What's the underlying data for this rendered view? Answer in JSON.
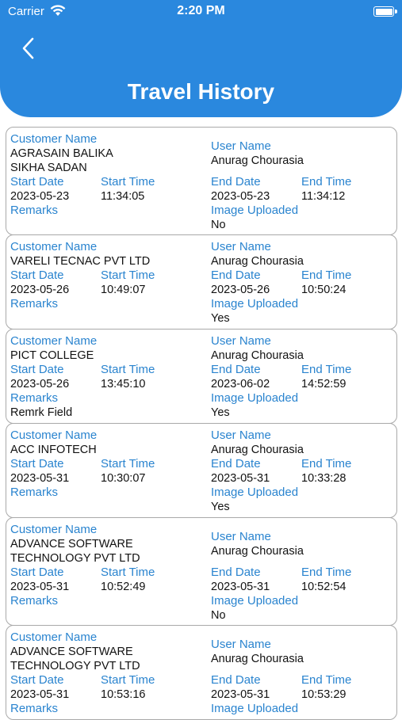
{
  "status_bar": {
    "carrier": "Carrier",
    "time": "2:20 PM"
  },
  "header": {
    "title": "Travel History"
  },
  "labels": {
    "customer_name": "Customer Name",
    "user_name": "User Name",
    "start_date": "Start Date",
    "start_time": "Start Time",
    "end_date": "End Date",
    "end_time": "End Time",
    "remarks": "Remarks",
    "image_uploaded": "Image Uploaded"
  },
  "records": [
    {
      "customer_line1": "AGRASAIN BALIKA",
      "customer_line2": "SIKHA SADAN",
      "user": "Anurag Chourasia",
      "start_date": "2023-05-23",
      "start_time": "11:34:05",
      "end_date": "2023-05-23",
      "end_time": "11:34:12",
      "remarks": "",
      "image_uploaded": "No"
    },
    {
      "customer_line1": "VARELI TECNAC PVT LTD",
      "customer_line2": "",
      "user": "Anurag Chourasia",
      "start_date": "2023-05-26",
      "start_time": "10:49:07",
      "end_date": "2023-05-26",
      "end_time": "10:50:24",
      "remarks": "",
      "image_uploaded": "Yes"
    },
    {
      "customer_line1": "PICT COLLEGE",
      "customer_line2": "",
      "user": "Anurag Chourasia",
      "start_date": "2023-05-26",
      "start_time": "13:45:10",
      "end_date": "2023-06-02",
      "end_time": "14:52:59",
      "remarks": "Remrk Field",
      "image_uploaded": "Yes"
    },
    {
      "customer_line1": "ACC INFOTECH",
      "customer_line2": "",
      "user": "Anurag Chourasia",
      "start_date": "2023-05-31",
      "start_time": "10:30:07",
      "end_date": "2023-05-31",
      "end_time": "10:33:28",
      "remarks": "",
      "image_uploaded": "Yes"
    },
    {
      "customer_line1": "ADVANCE SOFTWARE",
      "customer_line2": "TECHNOLOGY PVT LTD",
      "user": "Anurag Chourasia",
      "start_date": "2023-05-31",
      "start_time": "10:52:49",
      "end_date": "2023-05-31",
      "end_time": "10:52:54",
      "remarks": "",
      "image_uploaded": "No"
    },
    {
      "customer_line1": "ADVANCE SOFTWARE",
      "customer_line2": "TECHNOLOGY PVT LTD",
      "user": "Anurag Chourasia",
      "start_date": "2023-05-31",
      "start_time": "10:53:16",
      "end_date": "2023-05-31",
      "end_time": "10:53:29",
      "remarks": "",
      "image_uploaded": ""
    }
  ]
}
